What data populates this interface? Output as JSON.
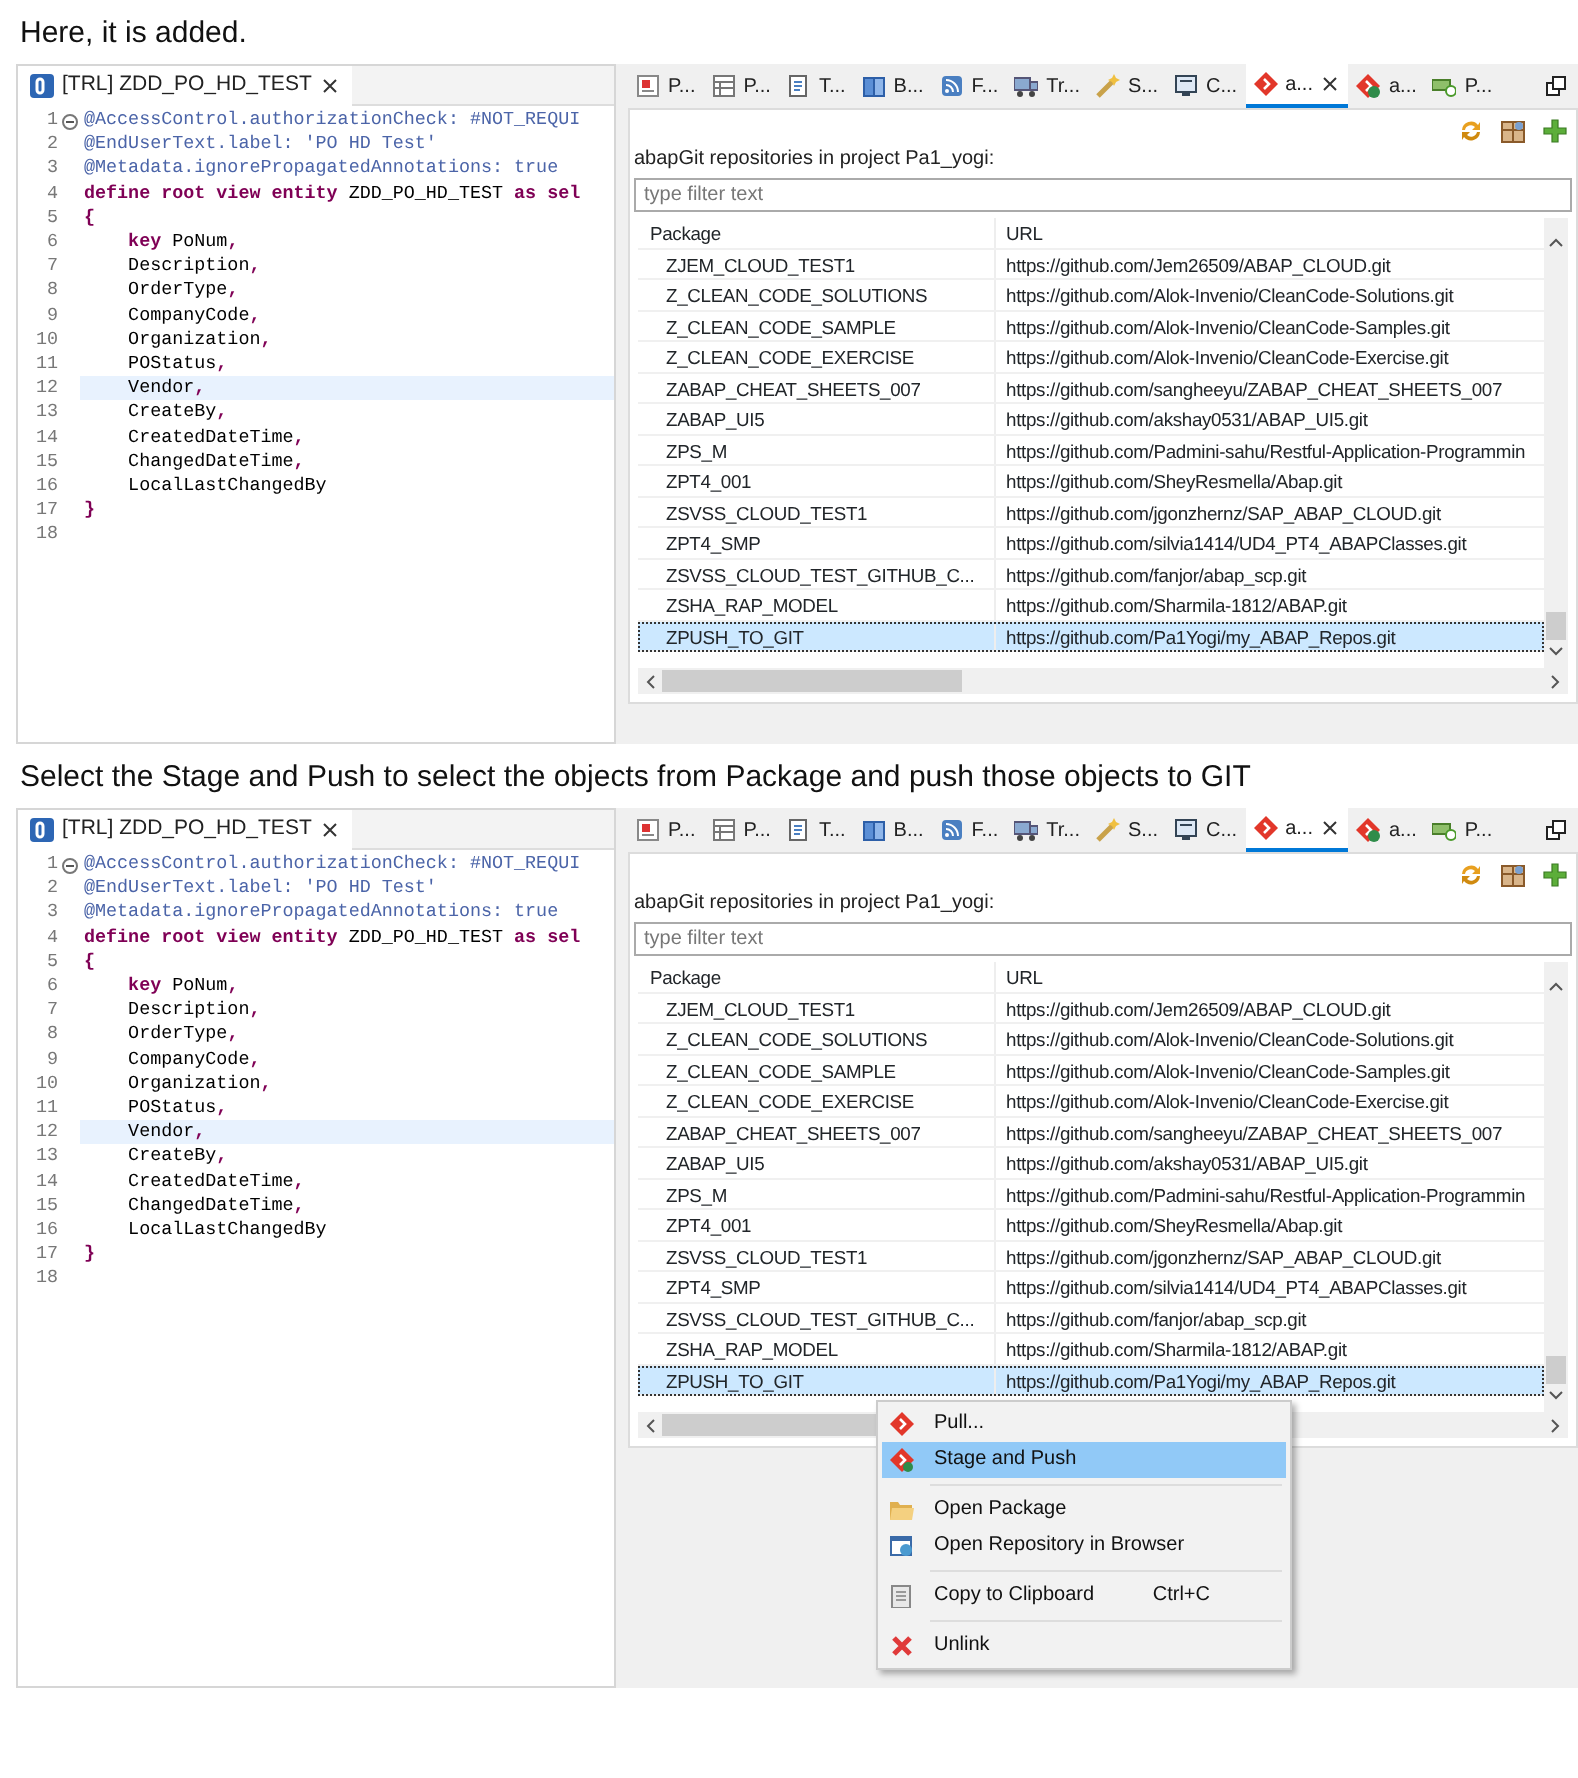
{
  "sections": [
    {
      "caption": "Here, it is added.",
      "editor": {
        "tab_label": "[TRL] ZDD_PO_HD_TEST",
        "lines": [
          {
            "number": "1",
            "foldable": true,
            "current": false,
            "segments": [
              {
                "kind": "annotation",
                "text": "@AccessControl.authorizationCheck: #NOT_REQUI"
              }
            ]
          },
          {
            "number": "2",
            "foldable": false,
            "current": false,
            "segments": [
              {
                "kind": "annotation",
                "text": "@EndUserText.label: 'PO HD Test'"
              }
            ]
          },
          {
            "number": "3",
            "foldable": false,
            "current": false,
            "segments": [
              {
                "kind": "annotation",
                "text": "@Metadata.ignorePropagatedAnnotations: true"
              }
            ]
          },
          {
            "number": "4",
            "foldable": false,
            "current": false,
            "segments": [
              {
                "kind": "keyword",
                "text": "define root view entity"
              },
              {
                "kind": "plain",
                "text": " ZDD_PO_HD_TEST "
              },
              {
                "kind": "keyword",
                "text": "as sel"
              }
            ]
          },
          {
            "number": "5",
            "foldable": false,
            "current": false,
            "segments": [
              {
                "kind": "keyword",
                "text": "{"
              }
            ]
          },
          {
            "number": "6",
            "foldable": false,
            "current": false,
            "segments": [
              {
                "kind": "keyword",
                "text": "    key"
              },
              {
                "kind": "plain",
                "text": " PoNum"
              },
              {
                "kind": "keyword",
                "text": ","
              }
            ]
          },
          {
            "number": "7",
            "foldable": false,
            "current": false,
            "segments": [
              {
                "kind": "plain",
                "text": "    Description"
              },
              {
                "kind": "keyword",
                "text": ","
              }
            ]
          },
          {
            "number": "8",
            "foldable": false,
            "current": false,
            "segments": [
              {
                "kind": "plain",
                "text": "    OrderType"
              },
              {
                "kind": "keyword",
                "text": ","
              }
            ]
          },
          {
            "number": "9",
            "foldable": false,
            "current": false,
            "segments": [
              {
                "kind": "plain",
                "text": "    CompanyCode"
              },
              {
                "kind": "keyword",
                "text": ","
              }
            ]
          },
          {
            "number": "10",
            "foldable": false,
            "current": false,
            "segments": [
              {
                "kind": "plain",
                "text": "    Organization"
              },
              {
                "kind": "keyword",
                "text": ","
              }
            ]
          },
          {
            "number": "11",
            "foldable": false,
            "current": false,
            "segments": [
              {
                "kind": "plain",
                "text": "    POStatus"
              },
              {
                "kind": "keyword",
                "text": ","
              }
            ]
          },
          {
            "number": "12",
            "foldable": false,
            "current": true,
            "segments": [
              {
                "kind": "plain",
                "text": "    Vendor"
              },
              {
                "kind": "keyword",
                "text": ","
              }
            ]
          },
          {
            "number": "13",
            "foldable": false,
            "current": false,
            "segments": [
              {
                "kind": "plain",
                "text": "    CreateBy"
              },
              {
                "kind": "keyword",
                "text": ","
              }
            ]
          },
          {
            "number": "14",
            "foldable": false,
            "current": false,
            "segments": [
              {
                "kind": "plain",
                "text": "    CreatedDateTime"
              },
              {
                "kind": "keyword",
                "text": ","
              }
            ]
          },
          {
            "number": "15",
            "foldable": false,
            "current": false,
            "segments": [
              {
                "kind": "plain",
                "text": "    ChangedDateTime"
              },
              {
                "kind": "keyword",
                "text": ","
              }
            ]
          },
          {
            "number": "16",
            "foldable": false,
            "current": false,
            "segments": [
              {
                "kind": "plain",
                "text": "    LocalLastChangedBy"
              }
            ]
          },
          {
            "number": "17",
            "foldable": false,
            "current": false,
            "segments": [
              {
                "kind": "keyword",
                "text": "}"
              }
            ]
          },
          {
            "number": "18",
            "foldable": false,
            "current": false
          }
        ]
      },
      "view": {
        "tabs": [
          {
            "label": "P...",
            "selected": false
          },
          {
            "label": "P...",
            "selected": false
          },
          {
            "label": "T...",
            "selected": false
          },
          {
            "label": "B...",
            "selected": false
          },
          {
            "label": "F...",
            "selected": false
          },
          {
            "label": "Tr...",
            "selected": false
          },
          {
            "label": "S...",
            "selected": false
          },
          {
            "label": "C...",
            "selected": false
          },
          {
            "label": "a...",
            "selected": true
          },
          {
            "label": "a...",
            "selected": false
          },
          {
            "label": "P...",
            "selected": false
          }
        ],
        "heading": "abapGit repositories in project Pa1_yogi:",
        "filter_placeholder": "type filter text",
        "columns": [
          "Package",
          "URL"
        ],
        "rows": [
          {
            "package": "ZJEM_CLOUD_TEST1",
            "url": "https://github.com/Jem26509/ABAP_CLOUD.git",
            "selected": false
          },
          {
            "package": "Z_CLEAN_CODE_SOLUTIONS",
            "url": "https://github.com/Alok-Invenio/CleanCode-Solutions.git",
            "selected": false
          },
          {
            "package": "Z_CLEAN_CODE_SAMPLE",
            "url": "https://github.com/Alok-Invenio/CleanCode-Samples.git",
            "selected": false
          },
          {
            "package": "Z_CLEAN_CODE_EXERCISE",
            "url": "https://github.com/Alok-Invenio/CleanCode-Exercise.git",
            "selected": false
          },
          {
            "package": "ZABAP_CHEAT_SHEETS_007",
            "url": "https://github.com/sangheeyu/ZABAP_CHEAT_SHEETS_007",
            "selected": false
          },
          {
            "package": "ZABAP_UI5",
            "url": "https://github.com/akshay0531/ABAP_UI5.git",
            "selected": false
          },
          {
            "package": "ZPS_M",
            "url": "https://github.com/Padmini-sahu/Restful-Application-Programmin",
            "selected": false
          },
          {
            "package": "ZPT4_001",
            "url": "https://github.com/SheyResmella/Abap.git",
            "selected": false
          },
          {
            "package": "ZSVSS_CLOUD_TEST1",
            "url": "https://github.com/jgonzhernz/SAP_ABAP_CLOUD.git",
            "selected": false
          },
          {
            "package": "ZPT4_SMP",
            "url": "https://github.com/silvia1414/UD4_PT4_ABAPClasses.git",
            "selected": false
          },
          {
            "package": "ZSVSS_CLOUD_TEST_GITHUB_C...",
            "url": "https://github.com/fanjor/abap_scp.git",
            "selected": false
          },
          {
            "package": "ZSHA_RAP_MODEL",
            "url": "https://github.com/Sharmila-1812/ABAP.git",
            "selected": false
          },
          {
            "package": "ZPUSH_TO_GIT",
            "url": "https://github.com/Pa1Yogi/my_ABAP_Repos.git",
            "selected": true
          }
        ]
      }
    },
    {
      "caption": "Select the Stage and Push to select the objects from Package and push those objects to GIT",
      "editor": {
        "tab_label": "[TRL] ZDD_PO_HD_TEST",
        "lines": [
          {
            "number": "1",
            "foldable": true,
            "current": false,
            "segments": [
              {
                "kind": "annotation",
                "text": "@AccessControl.authorizationCheck: #NOT_REQUI"
              }
            ]
          },
          {
            "number": "2",
            "foldable": false,
            "current": false,
            "segments": [
              {
                "kind": "annotation",
                "text": "@EndUserText.label: 'PO HD Test'"
              }
            ]
          },
          {
            "number": "3",
            "foldable": false,
            "current": false,
            "segments": [
              {
                "kind": "annotation",
                "text": "@Metadata.ignorePropagatedAnnotations: true"
              }
            ]
          },
          {
            "number": "4",
            "foldable": false,
            "current": false,
            "segments": [
              {
                "kind": "keyword",
                "text": "define root view entity"
              },
              {
                "kind": "plain",
                "text": " ZDD_PO_HD_TEST "
              },
              {
                "kind": "keyword",
                "text": "as sel"
              }
            ]
          },
          {
            "number": "5",
            "foldable": false,
            "current": false,
            "segments": [
              {
                "kind": "keyword",
                "text": "{"
              }
            ]
          },
          {
            "number": "6",
            "foldable": false,
            "current": false,
            "segments": [
              {
                "kind": "keyword",
                "text": "    key"
              },
              {
                "kind": "plain",
                "text": " PoNum"
              },
              {
                "kind": "keyword",
                "text": ","
              }
            ]
          },
          {
            "number": "7",
            "foldable": false,
            "current": false,
            "segments": [
              {
                "kind": "plain",
                "text": "    Description"
              },
              {
                "kind": "keyword",
                "text": ","
              }
            ]
          },
          {
            "number": "8",
            "foldable": false,
            "current": false,
            "segments": [
              {
                "kind": "plain",
                "text": "    OrderType"
              },
              {
                "kind": "keyword",
                "text": ","
              }
            ]
          },
          {
            "number": "9",
            "foldable": false,
            "current": false,
            "segments": [
              {
                "kind": "plain",
                "text": "    CompanyCode"
              },
              {
                "kind": "keyword",
                "text": ","
              }
            ]
          },
          {
            "number": "10",
            "foldable": false,
            "current": false,
            "segments": [
              {
                "kind": "plain",
                "text": "    Organization"
              },
              {
                "kind": "keyword",
                "text": ","
              }
            ]
          },
          {
            "number": "11",
            "foldable": false,
            "current": false,
            "segments": [
              {
                "kind": "plain",
                "text": "    POStatus"
              },
              {
                "kind": "keyword",
                "text": ","
              }
            ]
          },
          {
            "number": "12",
            "foldable": false,
            "current": true,
            "segments": [
              {
                "kind": "plain",
                "text": "    Vendor"
              },
              {
                "kind": "keyword",
                "text": ","
              }
            ]
          },
          {
            "number": "13",
            "foldable": false,
            "current": false,
            "segments": [
              {
                "kind": "plain",
                "text": "    CreateBy"
              },
              {
                "kind": "keyword",
                "text": ","
              }
            ]
          },
          {
            "number": "14",
            "foldable": false,
            "current": false,
            "segments": [
              {
                "kind": "plain",
                "text": "    CreatedDateTime"
              },
              {
                "kind": "keyword",
                "text": ","
              }
            ]
          },
          {
            "number": "15",
            "foldable": false,
            "current": false,
            "segments": [
              {
                "kind": "plain",
                "text": "    ChangedDateTime"
              },
              {
                "kind": "keyword",
                "text": ","
              }
            ]
          },
          {
            "number": "16",
            "foldable": false,
            "current": false,
            "segments": [
              {
                "kind": "plain",
                "text": "    LocalLastChangedBy"
              }
            ]
          },
          {
            "number": "17",
            "foldable": false,
            "current": false,
            "segments": [
              {
                "kind": "keyword",
                "text": "}"
              }
            ]
          },
          {
            "number": "18",
            "foldable": false,
            "current": false
          }
        ]
      },
      "view": {
        "tabs": [
          {
            "label": "P...",
            "selected": false
          },
          {
            "label": "P...",
            "selected": false
          },
          {
            "label": "T...",
            "selected": false
          },
          {
            "label": "B...",
            "selected": false
          },
          {
            "label": "F...",
            "selected": false
          },
          {
            "label": "Tr...",
            "selected": false
          },
          {
            "label": "S...",
            "selected": false
          },
          {
            "label": "C...",
            "selected": false
          },
          {
            "label": "a...",
            "selected": true
          },
          {
            "label": "a...",
            "selected": false
          },
          {
            "label": "P...",
            "selected": false
          }
        ],
        "heading": "abapGit repositories in project Pa1_yogi:",
        "filter_placeholder": "type filter text",
        "columns": [
          "Package",
          "URL"
        ],
        "rows": [
          {
            "package": "ZJEM_CLOUD_TEST1",
            "url": "https://github.com/Jem26509/ABAP_CLOUD.git",
            "selected": false
          },
          {
            "package": "Z_CLEAN_CODE_SOLUTIONS",
            "url": "https://github.com/Alok-Invenio/CleanCode-Solutions.git",
            "selected": false
          },
          {
            "package": "Z_CLEAN_CODE_SAMPLE",
            "url": "https://github.com/Alok-Invenio/CleanCode-Samples.git",
            "selected": false
          },
          {
            "package": "Z_CLEAN_CODE_EXERCISE",
            "url": "https://github.com/Alok-Invenio/CleanCode-Exercise.git",
            "selected": false
          },
          {
            "package": "ZABAP_CHEAT_SHEETS_007",
            "url": "https://github.com/sangheeyu/ZABAP_CHEAT_SHEETS_007",
            "selected": false
          },
          {
            "package": "ZABAP_UI5",
            "url": "https://github.com/akshay0531/ABAP_UI5.git",
            "selected": false
          },
          {
            "package": "ZPS_M",
            "url": "https://github.com/Padmini-sahu/Restful-Application-Programmin",
            "selected": false
          },
          {
            "package": "ZPT4_001",
            "url": "https://github.com/SheyResmella/Abap.git",
            "selected": false
          },
          {
            "package": "ZSVSS_CLOUD_TEST1",
            "url": "https://github.com/jgonzhernz/SAP_ABAP_CLOUD.git",
            "selected": false
          },
          {
            "package": "ZPT4_SMP",
            "url": "https://github.com/silvia1414/UD4_PT4_ABAPClasses.git",
            "selected": false
          },
          {
            "package": "ZSVSS_CLOUD_TEST_GITHUB_C...",
            "url": "https://github.com/fanjor/abap_scp.git",
            "selected": false
          },
          {
            "package": "ZSHA_RAP_MODEL",
            "url": "https://github.com/Sharmila-1812/ABAP.git",
            "selected": false
          },
          {
            "package": "ZPUSH_TO_GIT",
            "url": "https://github.com/Pa1Yogi/my_ABAP_Repos.git",
            "selected": true
          }
        ]
      },
      "context_menu": {
        "items": [
          {
            "kind": "item",
            "label": "Pull...",
            "selected": false
          },
          {
            "kind": "item",
            "label": "Stage and Push",
            "selected": true
          },
          {
            "kind": "separator"
          },
          {
            "kind": "item",
            "label": "Open Package",
            "selected": false
          },
          {
            "kind": "item",
            "label": "Open Repository in Browser",
            "selected": false
          },
          {
            "kind": "separator"
          },
          {
            "kind": "item",
            "label": "Copy to Clipboard",
            "shortcut": "Ctrl+C",
            "selected": false
          },
          {
            "kind": "separator"
          },
          {
            "kind": "item",
            "label": "Unlink",
            "selected": false
          }
        ]
      }
    }
  ]
}
